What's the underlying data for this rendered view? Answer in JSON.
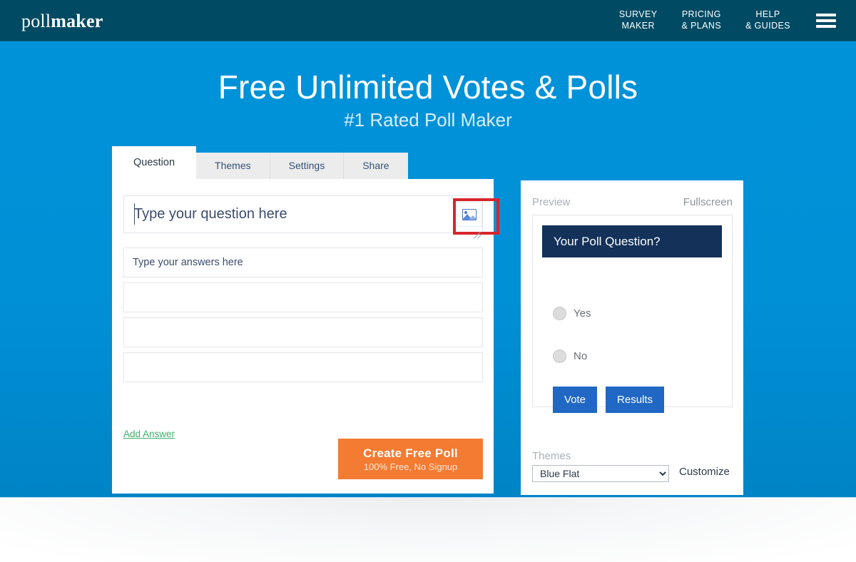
{
  "header": {
    "logo_light": "poll",
    "logo_bold": "maker",
    "nav": [
      {
        "line1": "SURVEY",
        "line2": "MAKER"
      },
      {
        "line1": "PRICING",
        "line2": "& PLANS"
      },
      {
        "line1": "HELP",
        "line2": "& GUIDES"
      }
    ],
    "menu_icon": "hamburger-icon"
  },
  "hero": {
    "title": "Free Unlimited Votes & Polls",
    "subtitle": "#1 Rated Poll Maker",
    "background_color": "#0090d6"
  },
  "builder": {
    "tabs": [
      {
        "label": "Question",
        "active": true
      },
      {
        "label": "Themes",
        "active": false
      },
      {
        "label": "Settings",
        "active": false
      },
      {
        "label": "Share",
        "active": false
      }
    ],
    "question": {
      "placeholder": "Type your question here",
      "value": "",
      "image_button_icon": "image-icon",
      "focused": true,
      "highlight_color": "#d8252c"
    },
    "answers": [
      {
        "placeholder": "Type your answers here",
        "value": ""
      },
      {
        "placeholder": "",
        "value": ""
      },
      {
        "placeholder": "",
        "value": ""
      },
      {
        "placeholder": "",
        "value": ""
      }
    ],
    "add_answer_label": "Add Answer",
    "add_answer_color": "#3fae6a",
    "create_button": {
      "title": "Create Free Poll",
      "subtitle": "100% Free, No Signup",
      "color": "#f47b32"
    }
  },
  "preview": {
    "label": "Preview",
    "fullscreen_label": "Fullscreen",
    "poll": {
      "question": "Your Poll Question?",
      "question_bar_color": "#133159",
      "options": [
        "Yes",
        "No"
      ],
      "vote_label": "Vote",
      "results_label": "Results",
      "button_color": "#2167c4"
    },
    "themes_label": "Themes",
    "theme_selected": "Blue Flat",
    "theme_options": [
      "Blue Flat"
    ],
    "customize_label": "Customize"
  }
}
